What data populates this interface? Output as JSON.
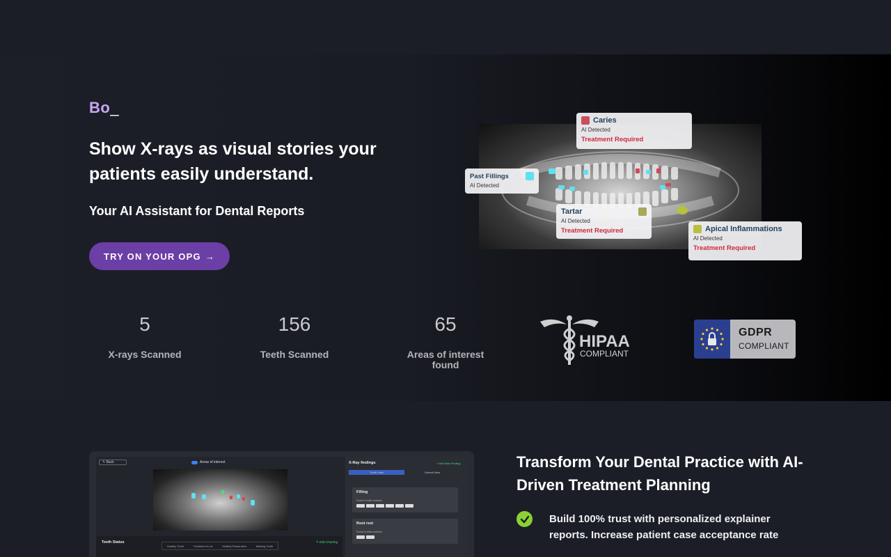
{
  "brand": {
    "logo": "Bo",
    "cursor": "_"
  },
  "hero": {
    "headline": "Show X-rays as visual stories your patients easily understand.",
    "subline": "Your AI Assistant for Dental Reports",
    "cta_label": "TRY ON YOUR OPG",
    "cta_arrow": "→"
  },
  "xray_cards": [
    {
      "title": "Caries",
      "detected": "AI Detected",
      "status": "Treatment Required",
      "color": "#c8505a"
    },
    {
      "title": "Past Fillings",
      "detected": "AI Detected",
      "status": "",
      "color": "#5fe0f0"
    },
    {
      "title": "Tartar",
      "detected": "AI Detected",
      "status": "Treatment Required",
      "color": "#a8a858"
    },
    {
      "title": "Apical Inflammations",
      "detected": "AI Detected",
      "status": "Treatment Required",
      "color": "#b8c040"
    }
  ],
  "stats": [
    {
      "value": "5",
      "label": "X-rays Scanned"
    },
    {
      "value": "156",
      "label": "Teeth Scanned"
    },
    {
      "value": "65",
      "label": "Areas of interest found"
    }
  ],
  "badges": {
    "hipaa_main": "HIPAA",
    "hipaa_sub": "COMPLIANT",
    "gdpr_main": "GDPR",
    "gdpr_sub": "COMPLIANT"
  },
  "app_preview": {
    "back": "↰ Back",
    "aoi": "Areas of interest",
    "teeth_status": "Teeth Status",
    "legend": [
      "Healthy Tooth",
      "Treatment to do",
      "Healthy Restoration",
      "Missing Tooth"
    ],
    "edit_charting": "✎ Edit Charting",
    "findings_title": "X-Ray findings",
    "add_finding": "+ Add New Finding",
    "tab_on": "Tooth View",
    "tab_off": "Overall View",
    "findings": [
      {
        "name": "Filling",
        "sub": "Found in tooth numbers"
      },
      {
        "name": "Root rest",
        "sub": "Found in tooth numbers"
      }
    ]
  },
  "section2": {
    "title": "Transform Your Dental Practice with AI-Driven Treatment Planning",
    "bullet": "Build 100% trust with personalized explainer reports. Increase patient case acceptance rate"
  },
  "colors": {
    "accent": "#6b3fa5",
    "logo": "#c9a7f0",
    "check": "#8bd133",
    "danger": "#d0283a"
  }
}
